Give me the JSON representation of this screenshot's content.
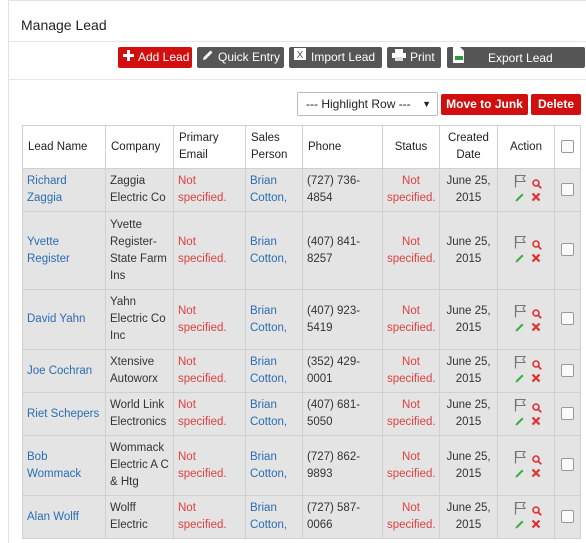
{
  "header": {
    "title": "Manage Lead"
  },
  "toolbar": {
    "add_lead": "Add Lead",
    "quick_entry": "Quick Entry",
    "import_lead": "Import Lead",
    "print": "Print",
    "export_lead": "Export Lead",
    "highlight_row": "--- Highlight Row ---",
    "move_to_junk": "Move to Junk",
    "delete": "Delete"
  },
  "table": {
    "columns": [
      "Lead Name",
      "Company",
      "Primary Email",
      "Sales Person",
      "Phone",
      "Status",
      "Created Date",
      "Action"
    ],
    "rows": [
      {
        "lead_name": "Richard Zaggia",
        "company": "Zaggia Electric Co",
        "email": "Not specified.",
        "sales_person": "Brian Cotton,",
        "phone": "(727) 736-4854",
        "status": "Not specified.",
        "created": "June 25, 2015"
      },
      {
        "lead_name": "Yvette Register",
        "company": "Yvette Register- State Farm Ins",
        "email": "Not specified.",
        "sales_person": "Brian Cotton,",
        "phone": "(407) 841-8257",
        "status": "Not specified.",
        "created": "June 25, 2015"
      },
      {
        "lead_name": "David Yahn",
        "company": "Yahn Electric Co Inc",
        "email": "Not specified.",
        "sales_person": "Brian Cotton,",
        "phone": "(407) 923-5419",
        "status": "Not specified.",
        "created": "June 25, 2015"
      },
      {
        "lead_name": "Joe Cochran",
        "company": "Xtensive Autoworx",
        "email": "Not specified.",
        "sales_person": "Brian Cotton,",
        "phone": "(352) 429-0001",
        "status": "Not specified.",
        "created": "June 25, 2015"
      },
      {
        "lead_name": "Riet Schepers",
        "company": "World Link Electronics",
        "email": "Not specified.",
        "sales_person": "Brian Cotton,",
        "phone": "(407) 681-5050",
        "status": "Not specified.",
        "created": "June 25, 2015"
      },
      {
        "lead_name": "Bob Wommack",
        "company": "Wommack Electric A C & Htg",
        "email": "Not specified.",
        "sales_person": "Brian Cotton,",
        "phone": "(727) 862-9893",
        "status": "Not specified.",
        "created": "June 25, 2015"
      },
      {
        "lead_name": "Alan Wolff",
        "company": "Wolff Electric",
        "email": "Not specified.",
        "sales_person": "Brian Cotton,",
        "phone": "(727) 587-0066",
        "status": "Not specified.",
        "created": "June 25, 2015"
      }
    ]
  },
  "colors": {
    "accent_red": "#d10f0f",
    "dark_button": "#565656",
    "link_blue": "#2a6db3",
    "not_specified_red": "#e04040",
    "row_bg": "#e4e4e4"
  },
  "icons": {
    "add": "plus-icon",
    "quick_entry": "pencil-icon",
    "import": "excel-icon",
    "print": "printer-icon",
    "export": "export-file-icon",
    "flag": "flag-icon",
    "view": "magnifier-icon",
    "edit": "pencil-icon",
    "delete": "x-icon",
    "highlight": "caret-down-icon"
  }
}
